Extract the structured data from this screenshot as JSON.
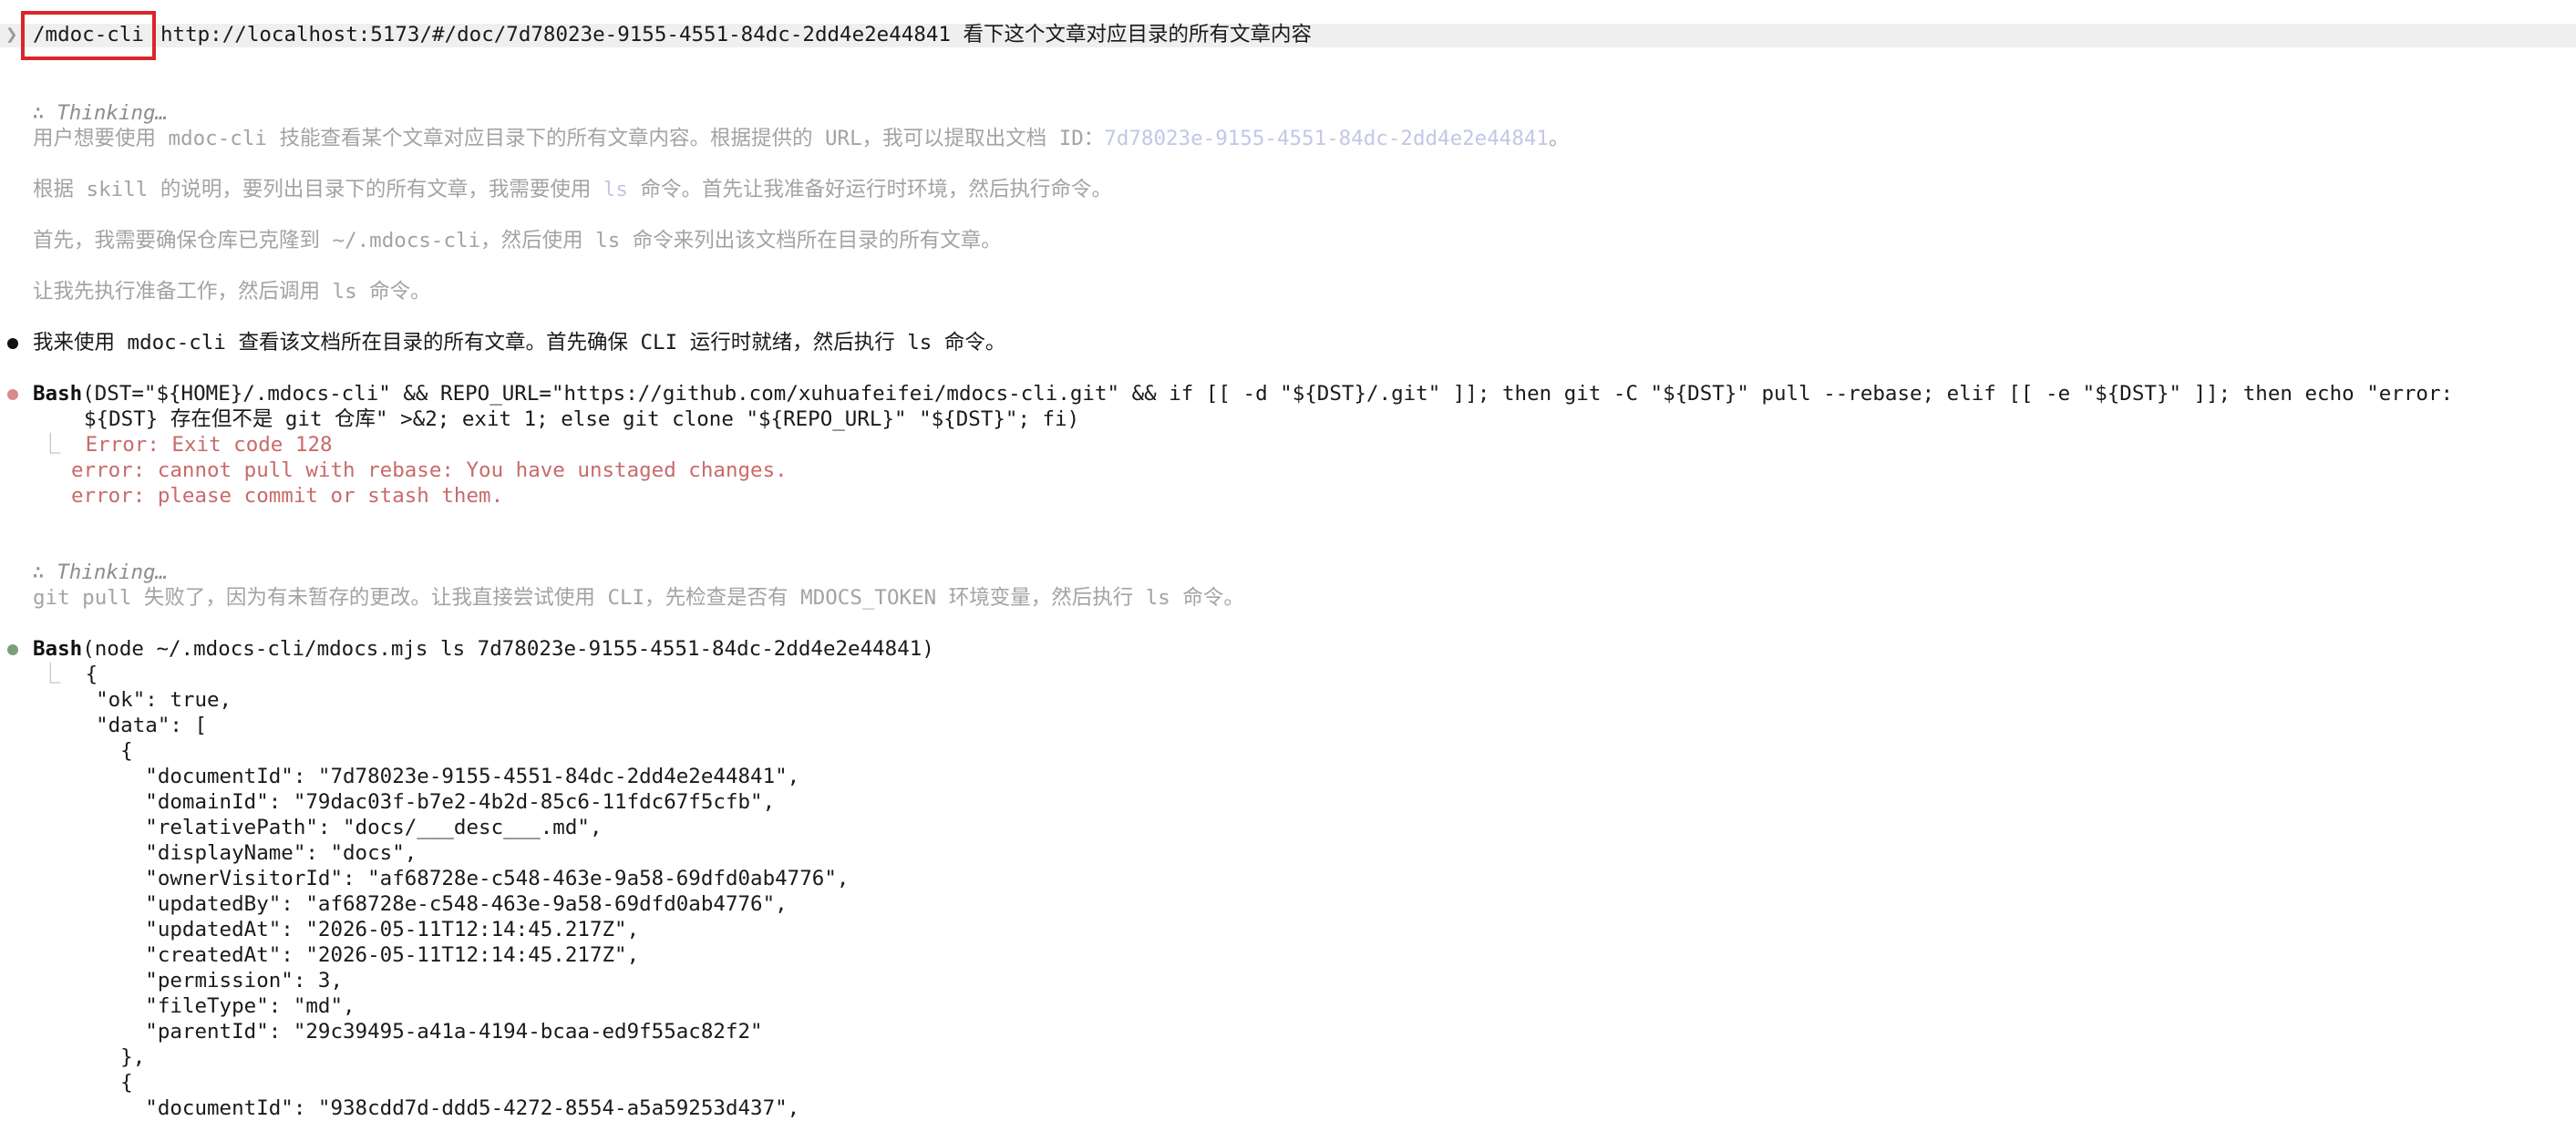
{
  "prompt": {
    "chevron": "❯",
    "command": "/mdoc-cli",
    "args": "http://localhost:5173/#/doc/7d78023e-9155-4551-84dc-2dd4e2e44841 看下这个文章对应目录的所有文章内容"
  },
  "thinking1": {
    "symbol": "∴",
    "label": "Thinking…",
    "p1_a": "用户想要使用 mdoc-cli 技能查看某个文章对应目录下的所有文章内容。根据提供的 URL，我可以提取出文档 ID：",
    "p1_id": "7d78023e-9155-4551-84dc-2dd4e2e44841",
    "p1_b": "。",
    "p2_a": "根据 skill 的说明，要列出目录下的所有文章，我需要使用 ",
    "p2_cmd": "ls",
    "p2_b": " 命令。首先让我准备好运行时环境，然后执行命令。",
    "p3": "首先，我需要确保仓库已克隆到 ~/.mdocs-cli，然后使用 ls 命令来列出该文档所在目录的所有文章。",
    "p4": "让我先执行准备工作，然后调用 ls 命令。"
  },
  "assistant_msg": "我来使用 mdoc-cli 查看该文档所在目录的所有文章。首先确保 CLI 运行时就绪，然后执行 ls 命令。",
  "bash1": {
    "tool": "Bash",
    "line1": "(DST=\"${HOME}/.mdocs-cli\" && REPO_URL=\"https://github.com/xuhuafeifei/mdocs-cli.git\" && if [[ -d \"${DST}/.git\" ]]; then git -C \"${DST}\" pull --rebase; elif [[ -e \"${DST}\" ]]; then echo \"error:",
    "line2": "${DST} 存在但不是 git 仓库\" >&2; exit 1; else git clone \"${REPO_URL}\" \"${DST}\"; fi)",
    "tree": "⎿",
    "err1": "Error: Exit code 128",
    "err2": "error: cannot pull with rebase: You have unstaged changes.",
    "err3": "error: please commit or stash them."
  },
  "thinking2": {
    "symbol": "∴",
    "label": "Thinking…",
    "p1": "git pull 失败了，因为有未暂存的更改。让我直接尝试使用 CLI，先检查是否有 MDOCS_TOKEN 环境变量，然后执行 ls 命令。"
  },
  "bash2": {
    "tool": "Bash",
    "call": "(node ~/.mdocs-cli/mdocs.mjs ls 7d78023e-9155-4551-84dc-2dd4e2e44841)",
    "tree": "⎿",
    "output": [
      "{",
      "  \"ok\": true,",
      "  \"data\": [",
      "    {",
      "      \"documentId\": \"7d78023e-9155-4551-84dc-2dd4e2e44841\",",
      "      \"domainId\": \"79dac03f-b7e2-4b2d-85c6-11fdc67f5cfb\",",
      "      \"relativePath\": \"docs/___desc___.md\",",
      "      \"displayName\": \"docs\",",
      "      \"ownerVisitorId\": \"af68728e-c548-463e-9a58-69dfd0ab4776\",",
      "      \"updatedBy\": \"af68728e-c548-463e-9a58-69dfd0ab4776\",",
      "      \"updatedAt\": \"2026-05-11T12:14:45.217Z\",",
      "      \"createdAt\": \"2026-05-11T12:14:45.217Z\",",
      "      \"permission\": 3,",
      "      \"fileType\": \"md\",",
      "      \"parentId\": \"29c39495-a41a-4194-bcaa-ed9f55ac82f2\"",
      "    },",
      "    {",
      "      \"documentId\": \"938cdd7d-ddd5-4272-8554-a5a59253d437\","
    ]
  }
}
